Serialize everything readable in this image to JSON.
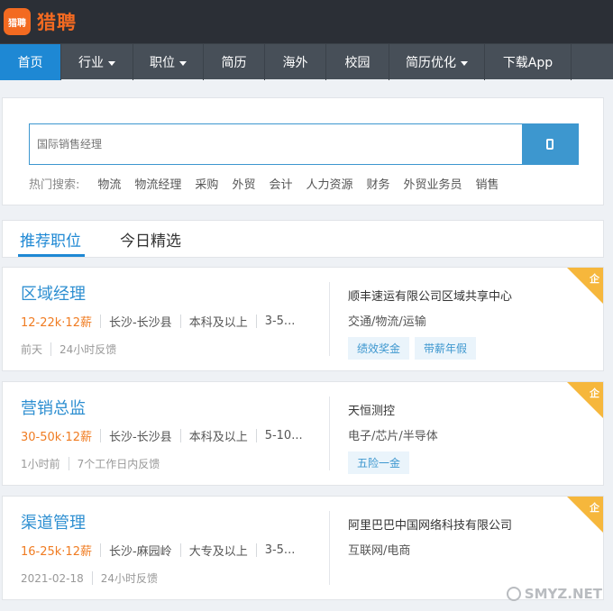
{
  "brand": {
    "badge": "猎聘",
    "name": "猎聘"
  },
  "nav": [
    {
      "label": "首页",
      "has_caret": false,
      "width": 68
    },
    {
      "label": "行业",
      "has_caret": true,
      "width": 80
    },
    {
      "label": "职位",
      "has_caret": true,
      "width": 78
    },
    {
      "label": "简历",
      "has_caret": false,
      "width": 68
    },
    {
      "label": "海外",
      "has_caret": false,
      "width": 68
    },
    {
      "label": "校园",
      "has_caret": false,
      "width": 70
    },
    {
      "label": "简历优化",
      "has_caret": true,
      "width": 106
    },
    {
      "label": "下载App",
      "has_caret": false,
      "width": 96
    }
  ],
  "search": {
    "placeholder": "国际销售经理",
    "hot_label": "热门搜索:",
    "hot_items": [
      "物流",
      "物流经理",
      "采购",
      "外贸",
      "会计",
      "人力资源",
      "财务",
      "外贸业务员",
      "销售"
    ]
  },
  "tabs": {
    "recommended": "推荐职位",
    "today": "今日精选"
  },
  "jobs": [
    {
      "title": "区域经理",
      "salary": "12-22k·12薪",
      "location": "长沙-长沙县",
      "education": "本科及以上",
      "experience": "3-5...",
      "posted": "前天",
      "feedback": "24小时反馈",
      "company": "顺丰速运有限公司区域共享中心",
      "industry": "交通/物流/运输",
      "tags": [
        "绩效奖金",
        "带薪年假"
      ],
      "badge": "企"
    },
    {
      "title": "营销总监",
      "salary": "30-50k·12薪",
      "location": "长沙-长沙县",
      "education": "本科及以上",
      "experience": "5-10...",
      "posted": "1小时前",
      "feedback": "7个工作日内反馈",
      "company": "天恒测控",
      "industry": "电子/芯片/半导体",
      "tags": [
        "五险一金"
      ],
      "badge": "企"
    },
    {
      "title": "渠道管理",
      "salary": "16-25k·12薪",
      "location": "长沙-麻园岭",
      "education": "大专及以上",
      "experience": "3-5...",
      "posted": "2021-02-18",
      "feedback": "24小时反馈",
      "company": "阿里巴巴中国网络科技有限公司",
      "industry": "互联网/电商",
      "tags": [],
      "badge": "企"
    }
  ],
  "watermark": "SMYZ.NET"
}
